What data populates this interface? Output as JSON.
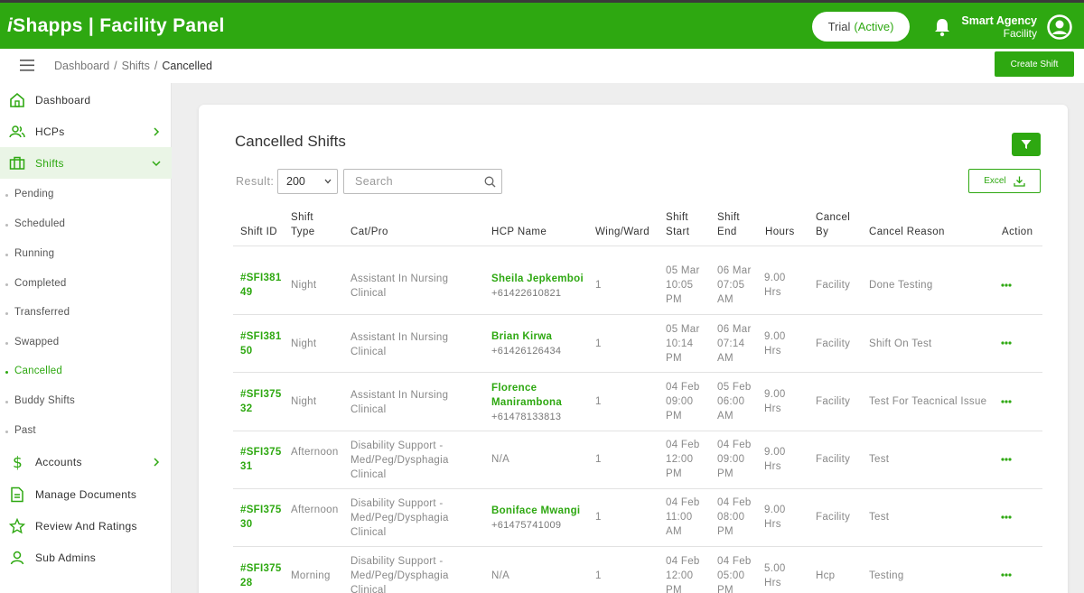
{
  "header": {
    "brand_prefix": "i",
    "brand_rest": "Shapps | Facility Panel",
    "trial_label": "Trial",
    "trial_status": "(Active)",
    "agency_name": "Smart Agency",
    "agency_role": "Facility"
  },
  "breadcrumb": {
    "items": [
      "Dashboard",
      "Shifts"
    ],
    "current": "Cancelled"
  },
  "create_shift_label": "Create Shift",
  "sidebar": {
    "items": [
      {
        "label": "Dashboard"
      },
      {
        "label": "HCPs"
      },
      {
        "label": "Shifts"
      },
      {
        "label": "Accounts"
      },
      {
        "label": "Manage Documents"
      },
      {
        "label": "Review And Ratings"
      },
      {
        "label": "Sub Admins"
      }
    ],
    "sub_items": [
      "Pending",
      "Scheduled",
      "Running",
      "Completed",
      "Transferred",
      "Swapped",
      "Cancelled",
      "Buddy Shifts",
      "Past"
    ]
  },
  "page": {
    "title": "Cancelled Shifts",
    "result_label": "Result:",
    "result_value": "200",
    "search_placeholder": "Search",
    "excel_label": "Excel"
  },
  "table": {
    "headers": {
      "shift_id": "Shift ID",
      "shift_type_1": "Shift",
      "shift_type_2": "Type",
      "cat_pro": "Cat/Pro",
      "hcp_name": "HCP Name",
      "wing_ward": "Wing/Ward",
      "start_1": "Shift",
      "start_2": "Start",
      "end_1": "Shift",
      "end_2": "End",
      "hours": "Hours",
      "cancel_by_1": "Cancel",
      "cancel_by_2": "By",
      "cancel_reason": "Cancel Reason",
      "action": "Action"
    },
    "rows": [
      {
        "id": "#SFI38149",
        "type": "Night",
        "cat1": "Assistant In Nursing",
        "cat2": "Clinical",
        "cat3": "",
        "hcp": "Sheila Jepkemboi",
        "phone": "+61422610821",
        "ward": "1",
        "start": [
          "05 Mar",
          "10:05",
          "PM"
        ],
        "end": [
          "06 Mar",
          "07:05",
          "AM"
        ],
        "hours": "9.00",
        "hrs": "Hrs",
        "by": "Facility",
        "reason": "Done Testing"
      },
      {
        "id": "#SFI38150",
        "type": "Night",
        "cat1": "Assistant In Nursing",
        "cat2": "Clinical",
        "cat3": "",
        "hcp": "Brian Kirwa",
        "phone": "+61426126434",
        "ward": "1",
        "start": [
          "05 Mar",
          "10:14",
          "PM"
        ],
        "end": [
          "06 Mar",
          "07:14",
          "AM"
        ],
        "hours": "9.00",
        "hrs": "Hrs",
        "by": "Facility",
        "reason": "Shift On Test"
      },
      {
        "id": "#SFI37532",
        "type": "Night",
        "cat1": "Assistant In Nursing",
        "cat2": "Clinical",
        "cat3": "",
        "hcp": "Florence Manirambona",
        "phone": "+61478133813",
        "ward": "1",
        "start": [
          "04 Feb",
          "09:00",
          "PM"
        ],
        "end": [
          "05 Feb",
          "06:00",
          "AM"
        ],
        "hours": "9.00",
        "hrs": "Hrs",
        "by": "Facility",
        "reason": "Test For Teacnical Issue"
      },
      {
        "id": "#SFI37531",
        "type": "Afternoon",
        "cat1": "Disability Support -",
        "cat2": "Med/Peg/Dysphagia",
        "cat3": "Clinical",
        "hcp": "N/A",
        "phone": "",
        "ward": "1",
        "start": [
          "04 Feb",
          "12:00",
          "PM"
        ],
        "end": [
          "04 Feb",
          "09:00",
          "PM"
        ],
        "hours": "9.00",
        "hrs": "Hrs",
        "by": "Facility",
        "reason": "Test"
      },
      {
        "id": "#SFI37530",
        "type": "Afternoon",
        "cat1": "Disability Support -",
        "cat2": "Med/Peg/Dysphagia",
        "cat3": "Clinical",
        "hcp": "Boniface Mwangi",
        "phone": "+61475741009",
        "ward": "1",
        "start": [
          "04 Feb",
          "11:00",
          "AM"
        ],
        "end": [
          "04 Feb",
          "08:00",
          "PM"
        ],
        "hours": "9.00",
        "hrs": "Hrs",
        "by": "Facility",
        "reason": "Test"
      },
      {
        "id": "#SFI37528",
        "type": "Morning",
        "cat1": "Disability Support -",
        "cat2": "Med/Peg/Dysphagia",
        "cat3": "Clinical",
        "hcp": "N/A",
        "phone": "",
        "ward": "1",
        "start": [
          "04 Feb",
          "12:00",
          "PM"
        ],
        "end": [
          "04 Feb",
          "05:00",
          "PM"
        ],
        "hours": "5.00",
        "hrs": "Hrs",
        "by": "Hcp",
        "reason": "Testing"
      }
    ]
  },
  "colors": {
    "brand": "#2ea811",
    "active_bg": "#eaf5e6"
  }
}
